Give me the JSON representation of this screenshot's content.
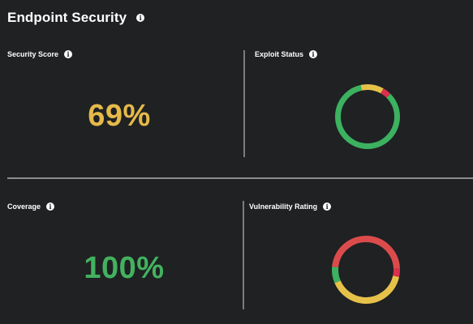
{
  "header": {
    "title": "Endpoint Security",
    "info_icon": "info-icon"
  },
  "panels": {
    "security_score": {
      "label": "Security Score",
      "value": "69%",
      "value_color": "#e6b94a"
    },
    "exploit_status": {
      "label": "Exploit Status",
      "segments": [
        {
          "status": "green",
          "color": "#3cb260",
          "fraction": 0.84
        },
        {
          "status": "yellow",
          "color": "#e6c14a",
          "fraction": 0.115
        },
        {
          "status": "red",
          "color": "#d9304d",
          "fraction": 0.045
        }
      ]
    },
    "coverage": {
      "label": "Coverage",
      "value": "100%",
      "value_color": "#43b25f"
    },
    "vulnerability_rating": {
      "label": "Vulnerability Rating",
      "segments": [
        {
          "status": "red-orange",
          "color": "#dc4b4b",
          "fraction": 0.48
        },
        {
          "status": "crimson",
          "color": "#d9304d",
          "fraction": 0.04
        },
        {
          "status": "yellow",
          "color": "#e6c14a",
          "fraction": 0.4
        },
        {
          "status": "green",
          "color": "#3cb260",
          "fraction": 0.08
        }
      ]
    }
  }
}
